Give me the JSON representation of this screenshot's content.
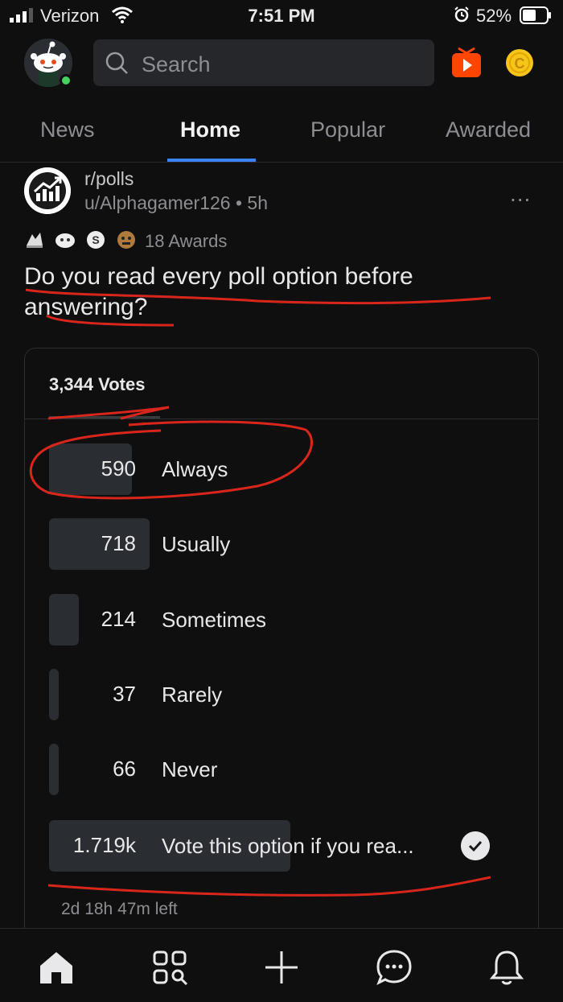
{
  "status_bar": {
    "carrier": "Verizon",
    "time": "7:51 PM",
    "battery_percent": "52%"
  },
  "header": {
    "search_placeholder": "Search",
    "icons": [
      "avatar",
      "search-icon",
      "video-icon",
      "coin-icon"
    ]
  },
  "tabs": [
    {
      "label": "News",
      "active": false
    },
    {
      "label": "Home",
      "active": true
    },
    {
      "label": "Popular",
      "active": false
    },
    {
      "label": "Awarded",
      "active": false
    }
  ],
  "post": {
    "subreddit": "r/polls",
    "author": "u/Alphagamer126",
    "age": "5h",
    "awards_count": "18 Awards",
    "title": "Do you read every poll option before answering?",
    "more_label": "...",
    "poll": {
      "total_votes": "3,344 Votes",
      "options": [
        {
          "count": "590",
          "label": "Always",
          "share": 0.343
        },
        {
          "count": "718",
          "label": "Usually",
          "share": 0.418
        },
        {
          "count": "214",
          "label": "Sometimes",
          "share": 0.124
        },
        {
          "count": "37",
          "label": "Rarely",
          "share": 0.022
        },
        {
          "count": "66",
          "label": "Never",
          "share": 0.038
        },
        {
          "count": "1.719k",
          "label": "Vote this option if you rea...",
          "share": 1.0,
          "selected": true
        }
      ],
      "time_left": "2d 18h 47m left"
    }
  },
  "colors": {
    "background": "#0f0f10",
    "accent": "#3b82f6",
    "annotation_red": "#d8261c",
    "online": "#46d160"
  }
}
